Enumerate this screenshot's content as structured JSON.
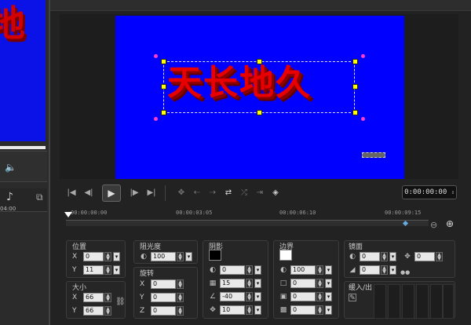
{
  "background_window": {
    "preview_text": "地",
    "time_label": "04:00"
  },
  "preview": {
    "title_text": "天长地久"
  },
  "playback": {
    "timecode": "0:00:00:00"
  },
  "ruler": {
    "ticks": [
      "00:00:00:00",
      "00:00:03:05",
      "00:00:06:10",
      "00:00:09:15"
    ]
  },
  "properties": {
    "position": {
      "label": "位置",
      "x_label": "X",
      "x_value": "0",
      "y_label": "Y",
      "y_value": "11"
    },
    "size": {
      "label": "大小",
      "x_label": "X",
      "x_value": "66",
      "y_label": "Y",
      "y_value": "66"
    },
    "opacity": {
      "label": "阻光度",
      "value": "100"
    },
    "rotation": {
      "label": "旋转",
      "x_label": "X",
      "x_value": "0",
      "y_label": "Y",
      "y_value": "0",
      "z_label": "Z",
      "z_value": "0"
    },
    "shadow": {
      "label": "阴影",
      "color": "#000000",
      "opacity_value": "0",
      "blur_value": "15",
      "angle_value": "-40",
      "distance_value": "10"
    },
    "border": {
      "label": "边界",
      "color": "#ffffff",
      "opacity_value": "100",
      "value_2": "0",
      "value_3": "0",
      "value_4": "0"
    },
    "mirror": {
      "label": "镜面",
      "value_1": "0",
      "value_2": "0",
      "move_value": "0",
      "value_3": "0"
    },
    "fade": {
      "label": "缓入/出"
    }
  },
  "colors": {
    "canvas": "#0000ff",
    "title_text": "#e80000",
    "handle": "#ffff00",
    "rotate_handle": "#ff3cc8"
  }
}
